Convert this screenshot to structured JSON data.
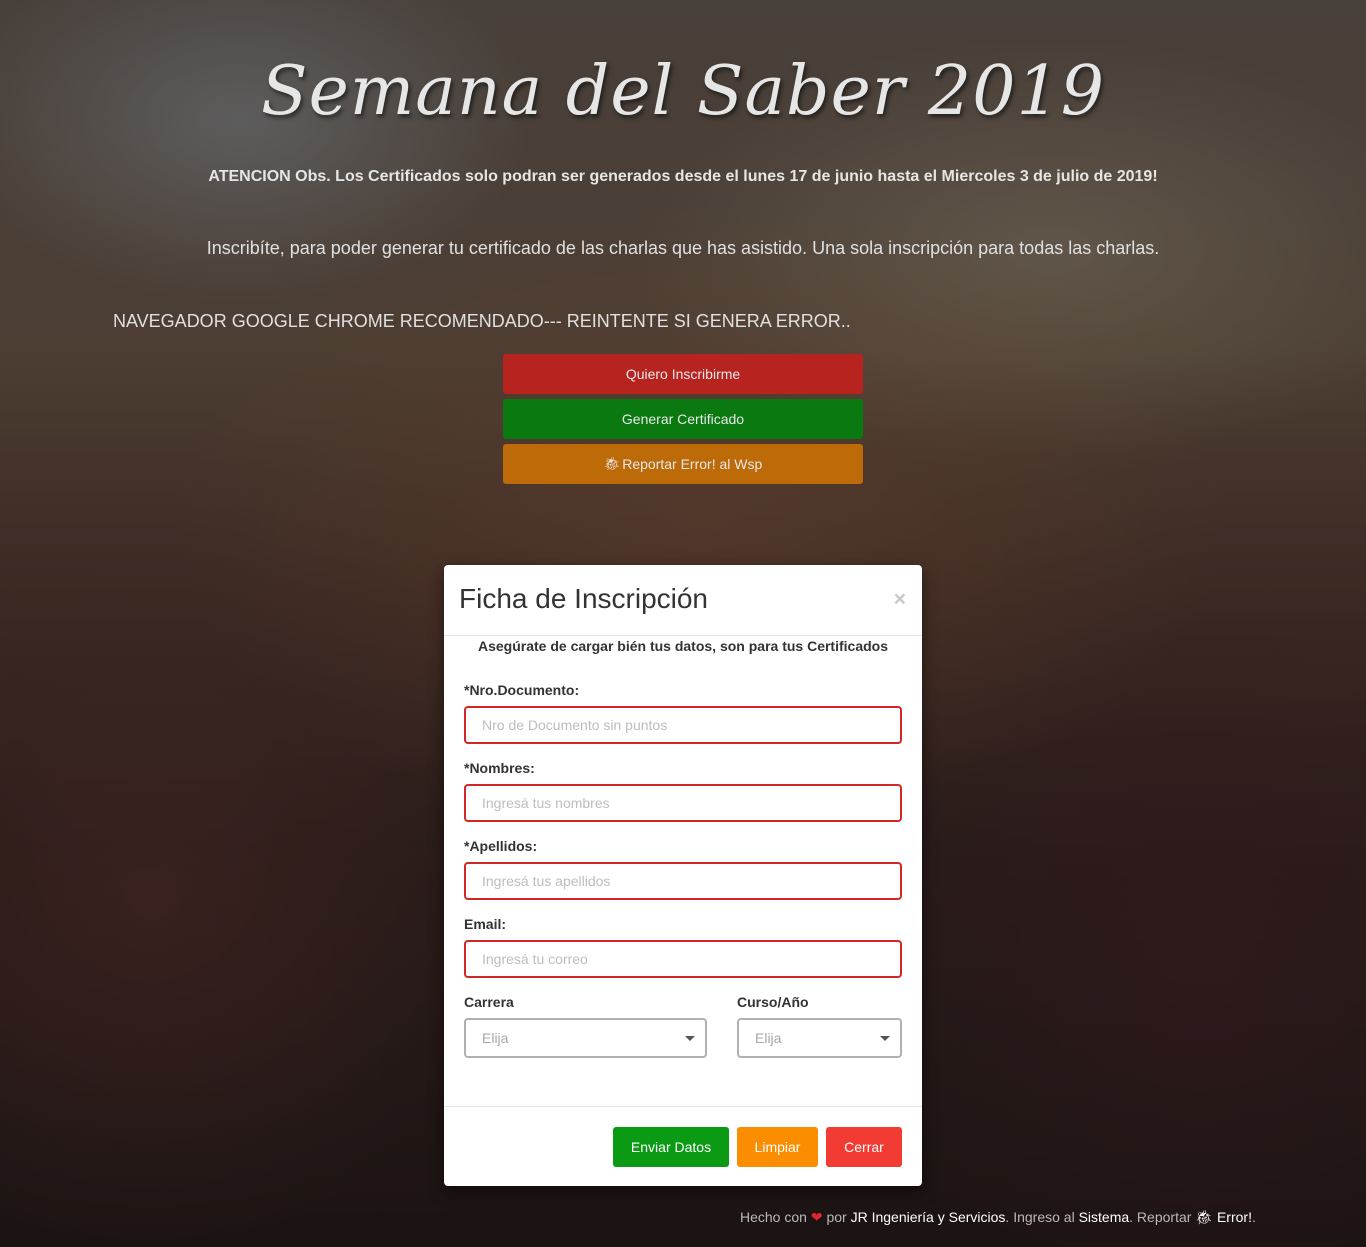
{
  "hero": {
    "title": "Semana del Saber 2019",
    "notice": "ATENCION Obs. Los Certificados solo podran ser generados desde el lunes 17 de junio hasta el Miercoles 3 de julio de 2019!",
    "intro": "Inscribíte, para poder generar tu certificado de las charlas que has asistido. Una sola inscripción para todas las charlas.",
    "browser_note": "NAVEGADOR GOOGLE CHROME RECOMENDADO--- REINTENTE SI GENERA ERROR..",
    "buttons": {
      "inscribe": "Quiero Inscribirme",
      "certificate": "Generar Certificado",
      "report_icon": "bug-icon",
      "report": "Reportar Error! al Wsp"
    }
  },
  "modal": {
    "title": "Ficha de Inscripción",
    "close_glyph": "×",
    "subtitle": "Asegúrate de cargar bién tus datos, son para tus Certificados",
    "fields": {
      "document": {
        "label": "*Nro.Documento:",
        "placeholder": "Nro de Documento sin puntos",
        "value": ""
      },
      "names": {
        "label": "*Nombres:",
        "placeholder": "Ingresá tus nombres",
        "value": ""
      },
      "surnames": {
        "label": "*Apellidos:",
        "placeholder": "Ingresá tus apellidos",
        "value": ""
      },
      "email": {
        "label": "Email:",
        "placeholder": "Ingresá tu correo",
        "value": ""
      },
      "career": {
        "label": "Carrera",
        "selected": "Elija"
      },
      "course": {
        "label": "Curso/Año",
        "selected": "Elija"
      }
    },
    "footer": {
      "send": "Enviar Datos",
      "clear": "Limpiar",
      "close": "Cerrar"
    }
  },
  "footer": {
    "made_with": "Hecho con",
    "heart_icon": "heart-icon",
    "by": "por",
    "company": "JR Ingeniería y Servicios",
    "login_text": ". Ingreso al",
    "system_link": "Sistema",
    "report_text": ". Reportar",
    "bug_icon": "bug-icon",
    "error_link": "Error!",
    "trailing": "."
  },
  "colors": {
    "inscribe": "#b7231f",
    "certificate": "#0a7a10",
    "report": "#bd6a08",
    "send": "#0a9a14",
    "clear": "#fa8d00",
    "close": "#f23b33",
    "input_border_error": "#d32626"
  }
}
